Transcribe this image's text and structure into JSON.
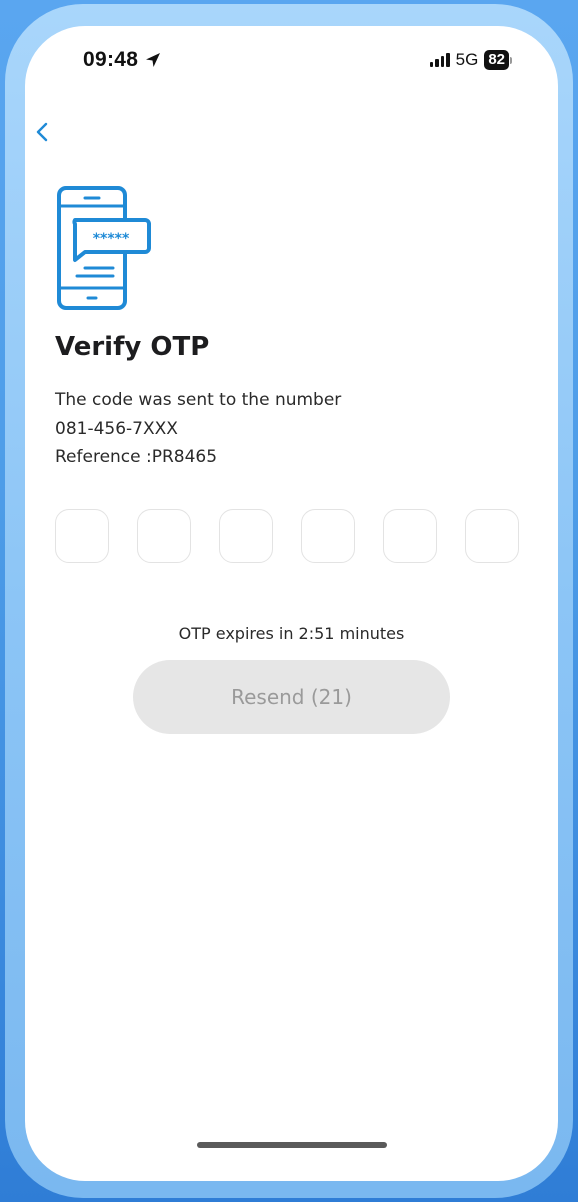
{
  "status_bar": {
    "time": "09:48",
    "network": "5G",
    "battery": "82"
  },
  "icons": {
    "back": "chevron-left-icon",
    "illustration": "phone-otp-icon",
    "location": "location-arrow-icon"
  },
  "colors": {
    "accent": "#1f8ad6",
    "button_bg": "#e6e6e6",
    "button_text": "#9a9a9a",
    "background": "#4e9de8"
  },
  "page": {
    "title": "Verify OTP",
    "description_line1": "The code was sent to the number",
    "phone_number": "081-456-7XXX",
    "reference": "Reference :PR8465",
    "illustration_text": "*****"
  },
  "otp": {
    "digits": [
      "",
      "",
      "",
      "",
      "",
      ""
    ],
    "expiry_text": "OTP expires in 2:51 minutes"
  },
  "resend_button": {
    "label": "Resend (21)"
  }
}
